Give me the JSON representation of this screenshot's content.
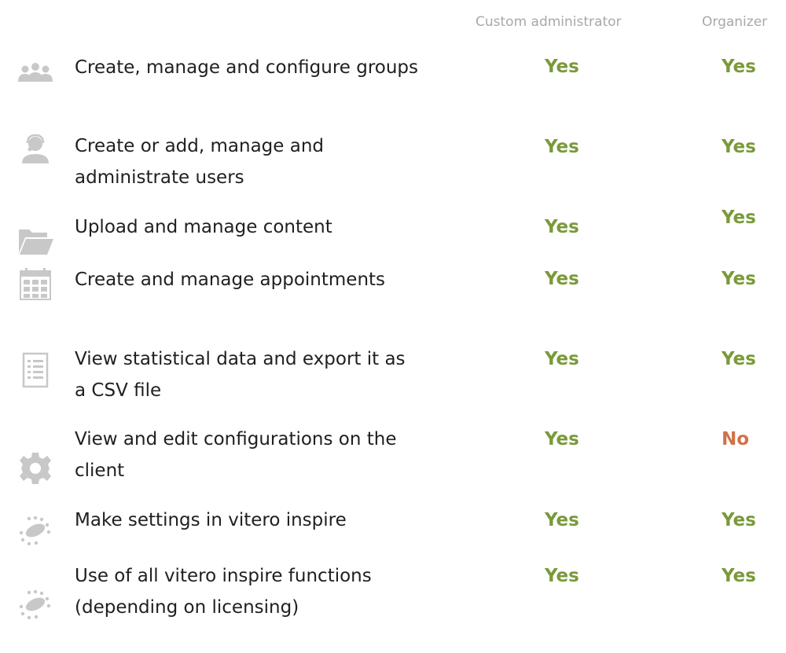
{
  "headers": {
    "admin": "Custom administrator",
    "organizer": "Organizer"
  },
  "colors": {
    "yes": "#7a9a3a",
    "no": "#d2714a",
    "icon": "#c8c8c8",
    "header_text": "#a8a8a8"
  },
  "rows": [
    {
      "icon": "group-icon",
      "label": "Create, manage and configure groups",
      "admin": "Yes",
      "organizer": "Yes"
    },
    {
      "icon": "user-headset-icon",
      "label": "Create or add, manage and administrate users",
      "admin": "Yes",
      "organizer": "Yes"
    },
    {
      "icon": "folder-icon",
      "label": "Upload and manage content",
      "admin": "Yes",
      "organizer": "Yes"
    },
    {
      "icon": "calendar-icon",
      "label": "Create and manage appointments",
      "admin": "Yes",
      "organizer": "Yes"
    },
    {
      "icon": "list-document-icon",
      "label": "View statistical data and export it as a CSV file",
      "admin": "Yes",
      "organizer": "Yes"
    },
    {
      "icon": "gear-icon",
      "label": "View and edit configurations on the client",
      "admin": "Yes",
      "organizer": "No"
    },
    {
      "icon": "vitero-inspire-icon",
      "label": "Make settings in vitero inspire",
      "admin": "Yes",
      "organizer": "Yes"
    },
    {
      "icon": "vitero-inspire-icon",
      "label": "Use of all vitero inspire functions (depending on licensing)",
      "admin": "Yes",
      "organizer": "Yes"
    }
  ]
}
